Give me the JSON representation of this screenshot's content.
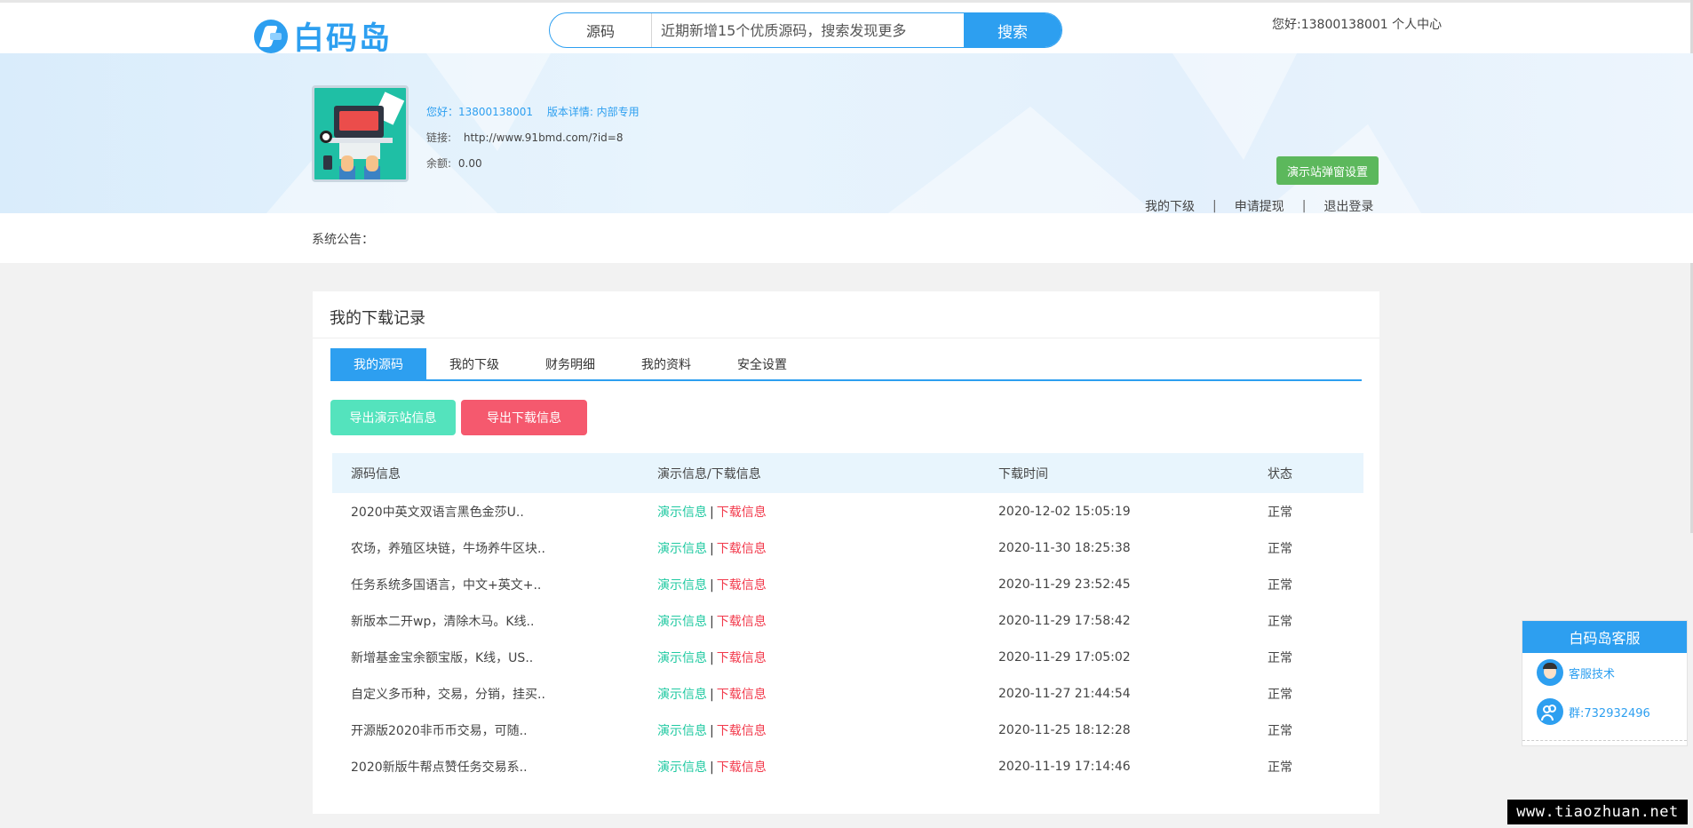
{
  "header": {
    "logo_text": "白码岛",
    "search": {
      "category": "源码",
      "placeholder": "近期新增15个优质源码，搜索发现更多",
      "button": "搜索"
    },
    "user_text": "您好:13800138001 个人中心"
  },
  "profile": {
    "greeting": "您好：13800138001",
    "version": "版本详情: 内部专用",
    "link_label": "链接:",
    "link_value": "http://www.91bmd.com/?id=8",
    "balance_label": "余额:",
    "balance_value": "0.00",
    "demo_button": "演示站弹窗设置",
    "links": [
      "我的下级",
      "申请提现",
      "退出登录"
    ],
    "separator": "|"
  },
  "notice": {
    "label": "系统公告："
  },
  "panel": {
    "title": "我的下载记录",
    "tabs": [
      "我的源码",
      "我的下级",
      "财务明细",
      "我的资料",
      "安全设置"
    ],
    "active_tab": "我的源码",
    "export_demo": "导出演示站信息",
    "export_download": "导出下载信息",
    "columns": [
      "源码信息",
      "演示信息/下载信息",
      "下载时间",
      "状态"
    ],
    "rows": [
      {
        "name": "2020中英文双语言黑色金莎U..",
        "demo": "演示信息",
        "download": "下载信息",
        "time": "2020-12-02 15:05:19",
        "status": "正常"
      },
      {
        "name": "农场，养殖区块链，牛场养牛区块..",
        "demo": "演示信息",
        "download": "下载信息",
        "time": "2020-11-30 18:25:38",
        "status": "正常"
      },
      {
        "name": "任务系统多国语言，中文+英文+..",
        "demo": "演示信息",
        "download": "下载信息",
        "time": "2020-11-29 23:52:45",
        "status": "正常"
      },
      {
        "name": "新版本二开wp，清除木马。K线..",
        "demo": "演示信息",
        "download": "下载信息",
        "time": "2020-11-29 17:58:42",
        "status": "正常"
      },
      {
        "name": "新增基金宝余额宝版，K线，US..",
        "demo": "演示信息",
        "download": "下载信息",
        "time": "2020-11-29 17:05:02",
        "status": "正常"
      },
      {
        "name": "自定义多币种，交易，分销，挂买..",
        "demo": "演示信息",
        "download": "下载信息",
        "time": "2020-11-27 21:44:54",
        "status": "正常"
      },
      {
        "name": "开源版2020非币币交易，可随..",
        "demo": "演示信息",
        "download": "下载信息",
        "time": "2020-11-25 18:12:28",
        "status": "正常"
      },
      {
        "name": "2020新版牛帮点赞任务交易系..",
        "demo": "演示信息",
        "download": "下载信息",
        "time": "2020-11-19 17:14:46",
        "status": "正常"
      }
    ]
  },
  "customer_service": {
    "title": "白码岛客服",
    "tech": "客服技术",
    "group": "群:732932496"
  },
  "watermark": "www.tiaozhuan.net",
  "colors": {
    "primary": "#2d9ff0",
    "green_button": "#5cb85c",
    "export_demo": "#54e3bd",
    "export_download": "#f5596e",
    "demo_link": "#1fc9a1",
    "download_link": "#f23a4c"
  }
}
